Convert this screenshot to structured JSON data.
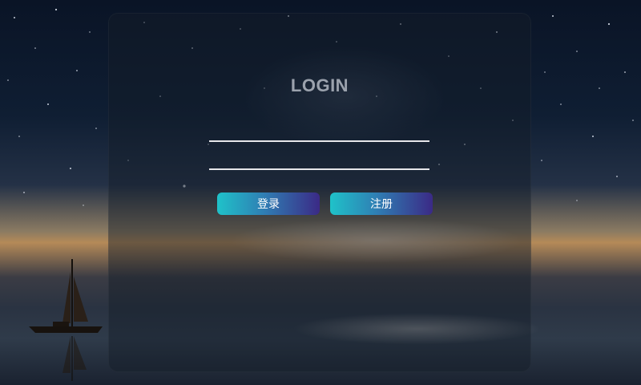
{
  "background": {
    "description": "night-sky-sea-sailboat"
  },
  "login": {
    "title": "LOGIN",
    "username": {
      "value": "",
      "placeholder": ""
    },
    "password": {
      "value": "",
      "placeholder": ""
    },
    "login_button_label": "登录",
    "register_button_label": "注册"
  },
  "colors": {
    "button_gradient_start": "#1fc2c9",
    "button_gradient_end": "#3b2a86",
    "title": "#9ba2ad",
    "input_underline": "#e6e6ea"
  }
}
